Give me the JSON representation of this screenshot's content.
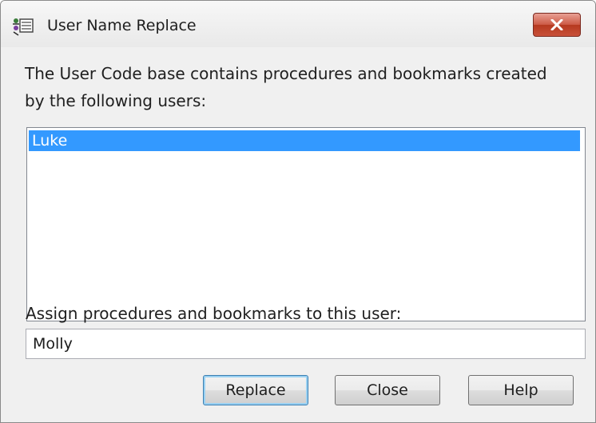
{
  "window": {
    "title": "User Name Replace",
    "icon": "users-replace-icon",
    "close_icon": "close-icon"
  },
  "description": "The User Code base contains procedures and bookmarks created by the following users:",
  "users_list": {
    "items": [
      "Luke"
    ],
    "selected": "Luke"
  },
  "assign_label": "Assign procedures and bookmarks to this user:",
  "assign_input": {
    "value": "Molly"
  },
  "buttons": {
    "replace": "Replace",
    "close": "Close",
    "help": "Help"
  },
  "colors": {
    "selection": "#3399ff",
    "close_button": "#c8513a"
  }
}
